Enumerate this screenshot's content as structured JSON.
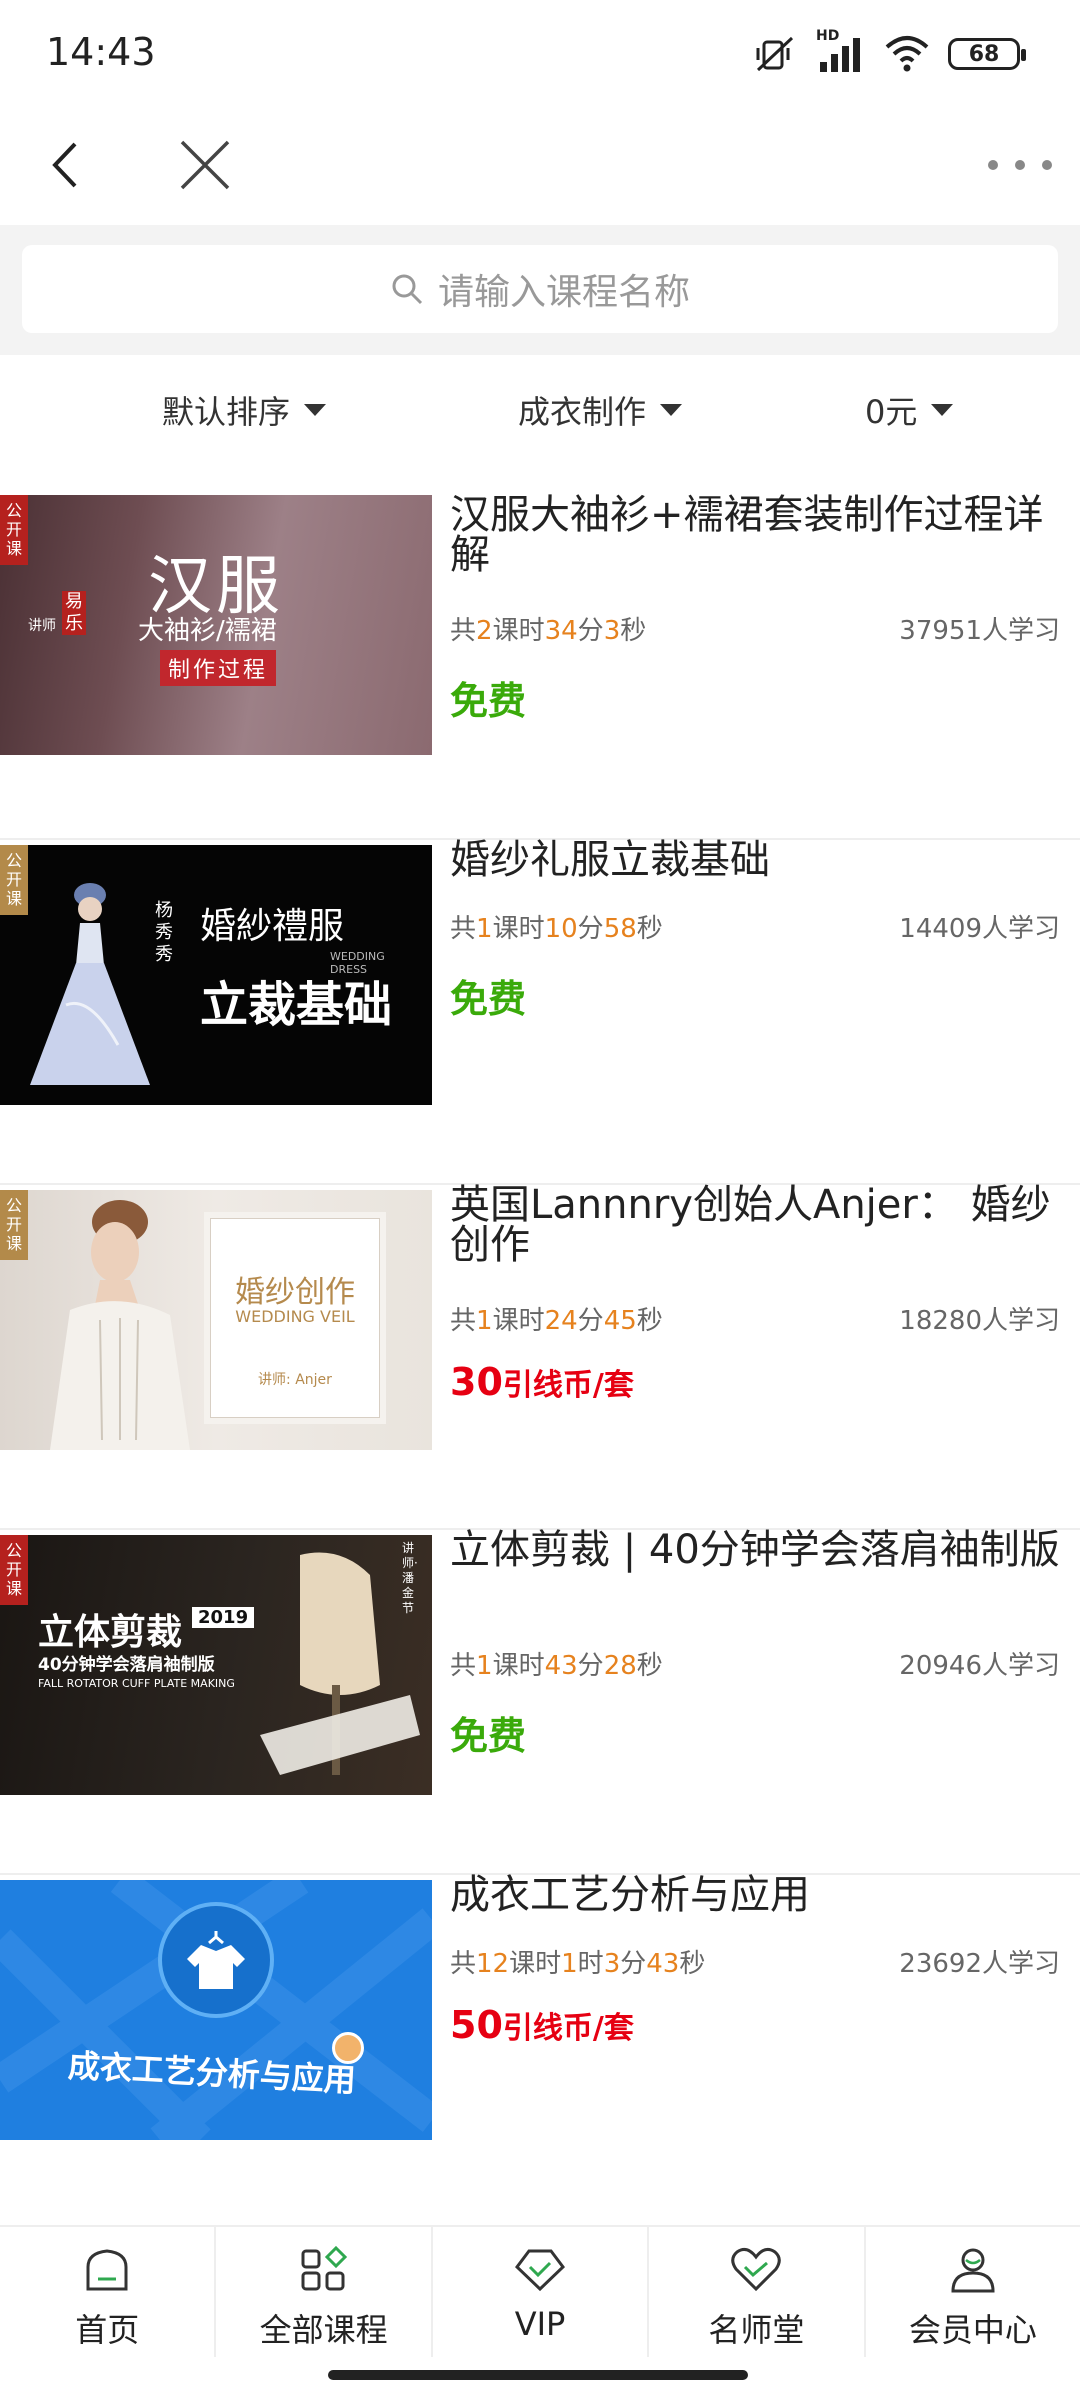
{
  "status": {
    "time": "14:43",
    "battery": "68",
    "network": "HD"
  },
  "nav": {
    "back_icon": "back-arrow-icon",
    "close_icon": "close-icon",
    "more_icon": "more-dots-icon"
  },
  "search": {
    "placeholder": "请输入课程名称"
  },
  "filters": [
    {
      "label": "默认排序"
    },
    {
      "label": "成衣制作"
    },
    {
      "label": "0元"
    }
  ],
  "courses": [
    {
      "title": "汉服大袖衫+襦裙套装制作过程详解",
      "meta": [
        {
          "t": "共"
        },
        {
          "t": "2",
          "n": true
        },
        {
          "t": "课时"
        },
        {
          "t": "34",
          "n": true
        },
        {
          "t": "分"
        },
        {
          "t": "3",
          "n": true
        },
        {
          "t": "秒"
        }
      ],
      "learners": "37951人学习",
      "price": "免费",
      "badge": "公开课",
      "thumb": {
        "main": "汉服",
        "sub": "大袖衫/襦裙",
        "tag": "制作过程",
        "teacher_label": "讲师",
        "teacher": "易乐"
      }
    },
    {
      "title": "婚纱礼服立裁基础",
      "meta": [
        {
          "t": "共"
        },
        {
          "t": "1",
          "n": true
        },
        {
          "t": "课时"
        },
        {
          "t": "10",
          "n": true
        },
        {
          "t": "分"
        },
        {
          "t": "58",
          "n": true
        },
        {
          "t": "秒"
        }
      ],
      "learners": "14409人学习",
      "price": "免费",
      "badge": "公开课",
      "thumb": {
        "main": "婚紗禮服",
        "sub": "立裁基础",
        "teacher": "杨秀秀",
        "en": "WEDDING DRESS"
      }
    },
    {
      "title": "英国Lannnry创始人Anjer： 婚纱创作",
      "meta": [
        {
          "t": "共"
        },
        {
          "t": "1",
          "n": true
        },
        {
          "t": "课时"
        },
        {
          "t": "24",
          "n": true
        },
        {
          "t": "分"
        },
        {
          "t": "45",
          "n": true
        },
        {
          "t": "秒"
        }
      ],
      "learners": "18280人学习",
      "price_amount": "30",
      "price_unit": "引线币/套",
      "badge": "公开课",
      "thumb": {
        "main": "婚纱创作",
        "en": "WEDDING VEIL",
        "teacher": "讲师: Anjer"
      }
    },
    {
      "title": "立体剪裁 | 40分钟学会落肩袖制版",
      "meta": [
        {
          "t": "共"
        },
        {
          "t": "1",
          "n": true
        },
        {
          "t": "课时"
        },
        {
          "t": "43",
          "n": true
        },
        {
          "t": "分"
        },
        {
          "t": "28",
          "n": true
        },
        {
          "t": "秒"
        }
      ],
      "learners": "20946人学习",
      "price": "免费",
      "badge": "公开课",
      "thumb": {
        "main": "立体剪裁",
        "year": "2019",
        "sub": "40分钟学会落肩袖制版",
        "en": "FALL ROTATOR CUFF PLATE MAKING",
        "teacher": "讲师·潘金节"
      }
    },
    {
      "title": "成衣工艺分析与应用",
      "meta": [
        {
          "t": "共"
        },
        {
          "t": "12",
          "n": true
        },
        {
          "t": "课时"
        },
        {
          "t": "1",
          "n": true
        },
        {
          "t": "时"
        },
        {
          "t": "3",
          "n": true
        },
        {
          "t": "分"
        },
        {
          "t": "43",
          "n": true
        },
        {
          "t": "秒"
        }
      ],
      "learners": "23692人学习",
      "price_amount": "50",
      "price_unit": "引线币/套",
      "thumb": {
        "main": "成衣工艺分析与应用"
      }
    }
  ],
  "tabs": [
    {
      "label": "首页",
      "icon": "home-icon"
    },
    {
      "label": "全部课程",
      "icon": "grid-icon"
    },
    {
      "label": "VIP",
      "icon": "vip-icon"
    },
    {
      "label": "名师堂",
      "icon": "heart-icon"
    },
    {
      "label": "会员中心",
      "icon": "user-icon"
    }
  ],
  "colors": {
    "free": "#3aaa0a",
    "paid": "#e60012",
    "number": "#e6821e"
  }
}
